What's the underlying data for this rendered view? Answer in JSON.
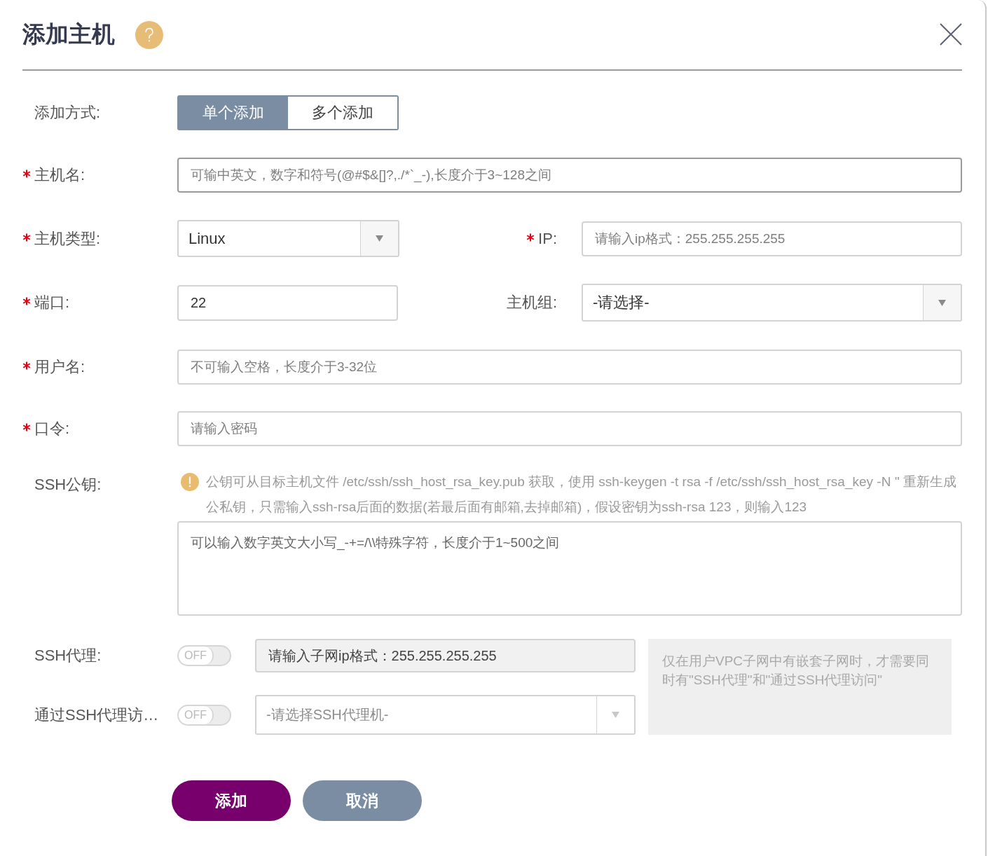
{
  "dialog": {
    "title": "添加主机"
  },
  "mode": {
    "label": "添加方式:",
    "required": false,
    "options": [
      {
        "label": "单个添加",
        "selected": true
      },
      {
        "label": "多个添加",
        "selected": false
      }
    ]
  },
  "hostname": {
    "label": "主机名:",
    "required": true,
    "focused": true,
    "placeholder": "可输中英文，数字和符号(@#$&[]?,./*`_-),长度介于3~128之间"
  },
  "host_type": {
    "label": "主机类型:",
    "required": true,
    "value": "Linux"
  },
  "ip": {
    "label": "IP:",
    "required": true,
    "placeholder": "请输入ip格式：255.255.255.255"
  },
  "port": {
    "label": "端口:",
    "required": true,
    "value": "22"
  },
  "host_group": {
    "label": "主机组:",
    "required": false,
    "value": "-请选择-"
  },
  "username": {
    "label": "用户名:",
    "required": true,
    "placeholder": "不可输入空格，长度介于3-32位"
  },
  "password": {
    "label": "口令:",
    "required": true,
    "placeholder": "请输入密码"
  },
  "ssh_key": {
    "label": "SSH公钥:",
    "required": false,
    "hint": "公钥可从目标主机文件 /etc/ssh/ssh_host_rsa_key.pub 获取，使用 ssh-keygen -t rsa -f /etc/ssh/ssh_host_rsa_key -N '' 重新生成公私钥，只需输入ssh-rsa后面的数据(若最后面有邮箱,去掉邮箱)，假设密钥为ssh-rsa 123，则输入123",
    "placeholder": "可以输入数字英文大小写_-+=/\\\\特殊字符，长度介于1~500之间"
  },
  "ssh_proxy": {
    "label": "SSH代理:",
    "required": false,
    "toggle": {
      "label": "OFF",
      "on": false
    },
    "placeholder": "请输入子网ip格式：255.255.255.255",
    "disabled": true
  },
  "proxy_access": {
    "label": "通过SSH代理访…",
    "required": false,
    "toggle": {
      "label": "OFF",
      "on": false
    },
    "placeholder": "-请选择SSH代理机-",
    "disabled": true
  },
  "proxy_note": "仅在用户VPC子网中有嵌套子网时，才需要同时有\"SSH代理\"和\"通过SSH代理访问\"",
  "buttons": [
    {
      "label": "添加",
      "kind": "primary"
    },
    {
      "label": "取消",
      "kind": "secondary"
    }
  ]
}
